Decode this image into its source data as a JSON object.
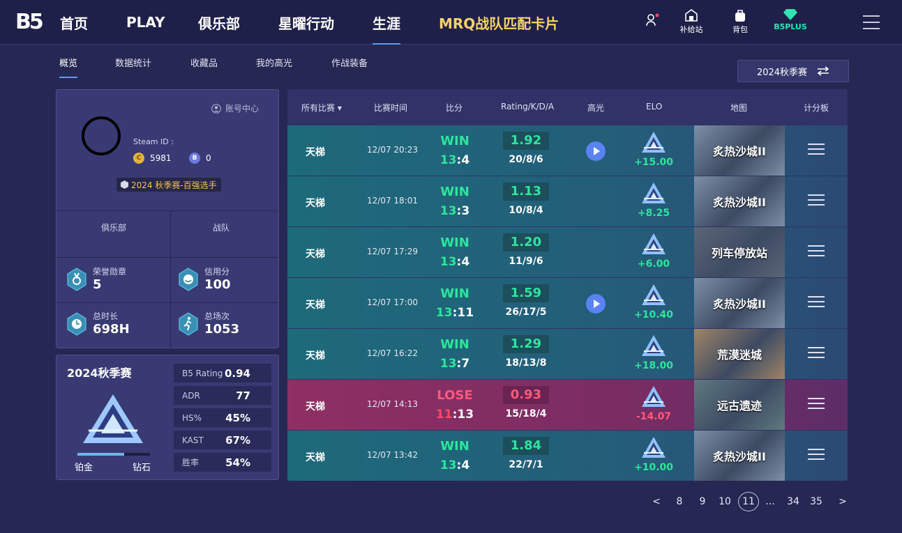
{
  "nav": {
    "logo": "B5",
    "items": [
      "首页",
      "PLAY",
      "俱乐部",
      "星曜行动",
      "生涯",
      "MRQ战队匹配卡片"
    ],
    "icons": {
      "supply": "补给站",
      "bag": "背包",
      "plus": "B5PLUS"
    }
  },
  "subtabs": [
    "概览",
    "数据统计",
    "收藏品",
    "我的高光",
    "作战装备"
  ],
  "season_switch": "2024秋季赛",
  "profile": {
    "account": "账号中心",
    "steam_label": "Steam ID :",
    "coin_c": "5981",
    "coin_b": "0",
    "badge": "2024 秋季赛-百强选手",
    "club_label": "俱乐部",
    "team_label": "战队",
    "stats": [
      {
        "label": "荣誉勋章",
        "value": "5"
      },
      {
        "label": "信用分",
        "value": "100"
      },
      {
        "label": "总时长",
        "value": "698H"
      },
      {
        "label": "总场次",
        "value": "1053"
      }
    ]
  },
  "season": {
    "title": "2024秋季赛",
    "rank_low": "铂金",
    "rank_high": "钻石",
    "progress": 0.64,
    "stats": [
      {
        "k": "B5 Rating",
        "v": "0.94"
      },
      {
        "k": "ADR",
        "v": "77"
      },
      {
        "k": "HS%",
        "v": "45%"
      },
      {
        "k": "KAST",
        "v": "67%"
      },
      {
        "k": "胜率",
        "v": "54%"
      }
    ]
  },
  "table": {
    "headers": [
      "所有比赛 ▾",
      "比赛时间",
      "比分",
      "Rating/K/D/A",
      "高光",
      "ELO",
      "地图",
      "计分板"
    ],
    "rows": [
      {
        "mode": "天梯",
        "time": "12/07 20:23",
        "result": "WIN",
        "s1": "13",
        "s2": "4",
        "rating": "1.92",
        "kda": "20/8/6",
        "highlight": true,
        "elo": "+15.00",
        "map": "炙热沙城II"
      },
      {
        "mode": "天梯",
        "time": "12/07 18:01",
        "result": "WIN",
        "s1": "13",
        "s2": "3",
        "rating": "1.13",
        "kda": "10/8/4",
        "highlight": false,
        "elo": "+8.25",
        "map": "炙热沙城II"
      },
      {
        "mode": "天梯",
        "time": "12/07 17:29",
        "result": "WIN",
        "s1": "13",
        "s2": "4",
        "rating": "1.20",
        "kda": "11/9/6",
        "highlight": false,
        "elo": "+6.00",
        "map": "列车停放站"
      },
      {
        "mode": "天梯",
        "time": "12/07 17:00",
        "result": "WIN",
        "s1": "13",
        "s2": "11",
        "rating": "1.59",
        "kda": "26/17/5",
        "highlight": true,
        "elo": "+10.40",
        "map": "炙热沙城II"
      },
      {
        "mode": "天梯",
        "time": "12/07 16:22",
        "result": "WIN",
        "s1": "13",
        "s2": "7",
        "rating": "1.29",
        "kda": "18/13/8",
        "highlight": false,
        "elo": "+18.00",
        "map": "荒漠迷城"
      },
      {
        "mode": "天梯",
        "time": "12/07 14:13",
        "result": "LOSE",
        "s1": "11",
        "s2": "13",
        "rating": "0.93",
        "kda": "15/18/4",
        "highlight": false,
        "elo": "-14.07",
        "map": "远古遗迹"
      },
      {
        "mode": "天梯",
        "time": "12/07 13:42",
        "result": "WIN",
        "s1": "13",
        "s2": "4",
        "rating": "1.84",
        "kda": "22/7/1",
        "highlight": false,
        "elo": "+10.00",
        "map": "炙热沙城II"
      }
    ]
  },
  "pagination": {
    "prev": "<",
    "pages": [
      "8",
      "9",
      "10",
      "11",
      "...",
      "34",
      "35"
    ],
    "current": "11",
    "next": ">"
  },
  "colors": {
    "bg": "#262753",
    "win": "#2ee59c",
    "lose": "#ff5a7a",
    "accent": "#5e9bf0",
    "gold": "#f4d36b"
  }
}
